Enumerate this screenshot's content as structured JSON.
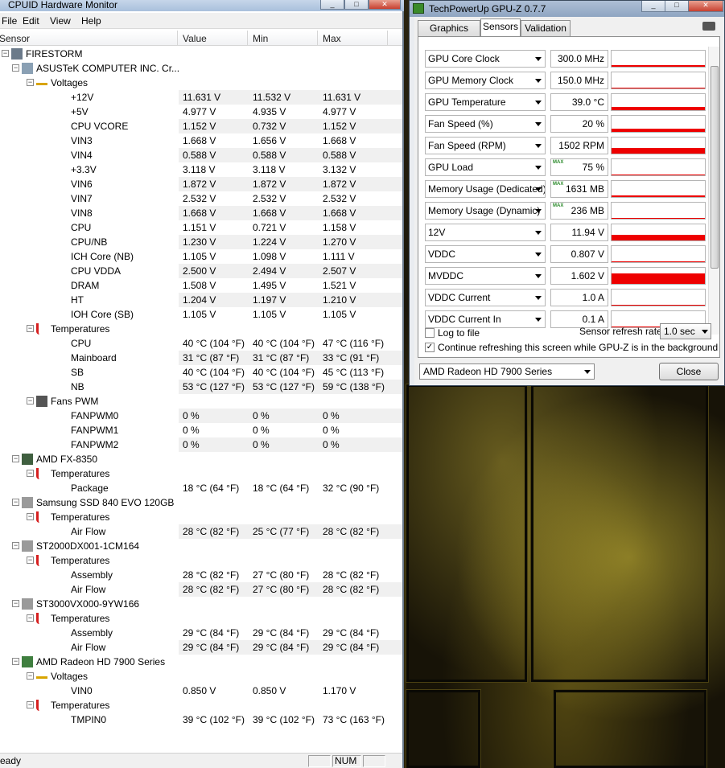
{
  "hwmonitor": {
    "title": "CPUID Hardware Monitor",
    "menu": [
      "File",
      "Edit",
      "View",
      "Help"
    ],
    "columns": {
      "sensor": "Sensor",
      "value": "Value",
      "min": "Min",
      "max": "Max"
    },
    "status": {
      "ready": "eady",
      "num": "NUM"
    },
    "rows": [
      {
        "indent": 0,
        "type": "root",
        "icon": "computer-icon",
        "label": "FIRESTORM"
      },
      {
        "indent": 1,
        "type": "device",
        "icon": "motherboard-icon",
        "label": "ASUSTeK COMPUTER INC. Cr..."
      },
      {
        "indent": 2,
        "type": "group",
        "icon": "voltage-icon",
        "label": "Voltages"
      },
      {
        "indent": 3,
        "type": "sensor",
        "label": "+12V",
        "value": "11.631 V",
        "min": "11.532 V",
        "max": "11.631 V"
      },
      {
        "indent": 3,
        "type": "sensor",
        "label": "+5V",
        "value": "4.977 V",
        "min": "4.935 V",
        "max": "4.977 V"
      },
      {
        "indent": 3,
        "type": "sensor",
        "label": "CPU VCORE",
        "value": "1.152 V",
        "min": "0.732 V",
        "max": "1.152 V"
      },
      {
        "indent": 3,
        "type": "sensor",
        "label": "VIN3",
        "value": "1.668 V",
        "min": "1.656 V",
        "max": "1.668 V"
      },
      {
        "indent": 3,
        "type": "sensor",
        "label": "VIN4",
        "value": "0.588 V",
        "min": "0.588 V",
        "max": "0.588 V"
      },
      {
        "indent": 3,
        "type": "sensor",
        "label": "+3.3V",
        "value": "3.118 V",
        "min": "3.118 V",
        "max": "3.132 V"
      },
      {
        "indent": 3,
        "type": "sensor",
        "label": "VIN6",
        "value": "1.872 V",
        "min": "1.872 V",
        "max": "1.872 V"
      },
      {
        "indent": 3,
        "type": "sensor",
        "label": "VIN7",
        "value": "2.532 V",
        "min": "2.532 V",
        "max": "2.532 V"
      },
      {
        "indent": 3,
        "type": "sensor",
        "label": "VIN8",
        "value": "1.668 V",
        "min": "1.668 V",
        "max": "1.668 V"
      },
      {
        "indent": 3,
        "type": "sensor",
        "label": "CPU",
        "value": "1.151 V",
        "min": "0.721 V",
        "max": "1.158 V"
      },
      {
        "indent": 3,
        "type": "sensor",
        "label": "CPU/NB",
        "value": "1.230 V",
        "min": "1.224 V",
        "max": "1.270 V"
      },
      {
        "indent": 3,
        "type": "sensor",
        "label": "ICH Core (NB)",
        "value": "1.105 V",
        "min": "1.098 V",
        "max": "1.111 V"
      },
      {
        "indent": 3,
        "type": "sensor",
        "label": "CPU VDDA",
        "value": "2.500 V",
        "min": "2.494 V",
        "max": "2.507 V"
      },
      {
        "indent": 3,
        "type": "sensor",
        "label": "DRAM",
        "value": "1.508 V",
        "min": "1.495 V",
        "max": "1.521 V"
      },
      {
        "indent": 3,
        "type": "sensor",
        "label": "HT",
        "value": "1.204 V",
        "min": "1.197 V",
        "max": "1.210 V"
      },
      {
        "indent": 3,
        "type": "sensor",
        "label": "IOH Core (SB)",
        "value": "1.105 V",
        "min": "1.105 V",
        "max": "1.105 V"
      },
      {
        "indent": 2,
        "type": "group",
        "icon": "thermometer-icon",
        "label": "Temperatures"
      },
      {
        "indent": 3,
        "type": "sensor",
        "label": "CPU",
        "value": "40 °C  (104 °F)",
        "min": "40 °C  (104 °F)",
        "max": "47 °C  (116 °F)"
      },
      {
        "indent": 3,
        "type": "sensor",
        "label": "Mainboard",
        "value": "31 °C  (87 °F)",
        "min": "31 °C  (87 °F)",
        "max": "33 °C  (91 °F)"
      },
      {
        "indent": 3,
        "type": "sensor",
        "label": "SB",
        "value": "40 °C  (104 °F)",
        "min": "40 °C  (104 °F)",
        "max": "45 °C  (113 °F)"
      },
      {
        "indent": 3,
        "type": "sensor",
        "label": "NB",
        "value": "53 °C  (127 °F)",
        "min": "53 °C  (127 °F)",
        "max": "59 °C  (138 °F)"
      },
      {
        "indent": 2,
        "type": "group",
        "icon": "fan-icon",
        "label": "Fans PWM"
      },
      {
        "indent": 3,
        "type": "sensor",
        "label": "FANPWM0",
        "value": "0 %",
        "min": "0 %",
        "max": "0 %"
      },
      {
        "indent": 3,
        "type": "sensor",
        "label": "FANPWM1",
        "value": "0 %",
        "min": "0 %",
        "max": "0 %"
      },
      {
        "indent": 3,
        "type": "sensor",
        "label": "FANPWM2",
        "value": "0 %",
        "min": "0 %",
        "max": "0 %"
      },
      {
        "indent": 1,
        "type": "device",
        "icon": "cpu-chip-icon",
        "label": "AMD FX-8350"
      },
      {
        "indent": 2,
        "type": "group",
        "icon": "thermometer-icon",
        "label": "Temperatures"
      },
      {
        "indent": 3,
        "type": "sensor",
        "label": "Package",
        "value": "18 °C  (64 °F)",
        "min": "18 °C  (64 °F)",
        "max": "32 °C  (90 °F)"
      },
      {
        "indent": 1,
        "type": "device",
        "icon": "drive-icon",
        "label": "Samsung SSD 840 EVO 120GB"
      },
      {
        "indent": 2,
        "type": "group",
        "icon": "thermometer-icon",
        "label": "Temperatures"
      },
      {
        "indent": 3,
        "type": "sensor",
        "label": "Air Flow",
        "value": "28 °C  (82 °F)",
        "min": "25 °C  (77 °F)",
        "max": "28 °C  (82 °F)"
      },
      {
        "indent": 1,
        "type": "device",
        "icon": "drive-icon",
        "label": "ST2000DX001-1CM164"
      },
      {
        "indent": 2,
        "type": "group",
        "icon": "thermometer-icon",
        "label": "Temperatures"
      },
      {
        "indent": 3,
        "type": "sensor",
        "label": "Assembly",
        "value": "28 °C  (82 °F)",
        "min": "27 °C  (80 °F)",
        "max": "28 °C  (82 °F)"
      },
      {
        "indent": 3,
        "type": "sensor",
        "label": "Air Flow",
        "value": "28 °C  (82 °F)",
        "min": "27 °C  (80 °F)",
        "max": "28 °C  (82 °F)"
      },
      {
        "indent": 1,
        "type": "device",
        "icon": "drive-icon",
        "label": "ST3000VX000-9YW166"
      },
      {
        "indent": 2,
        "type": "group",
        "icon": "thermometer-icon",
        "label": "Temperatures"
      },
      {
        "indent": 3,
        "type": "sensor",
        "label": "Assembly",
        "value": "29 °C  (84 °F)",
        "min": "29 °C  (84 °F)",
        "max": "29 °C  (84 °F)"
      },
      {
        "indent": 3,
        "type": "sensor",
        "label": "Air Flow",
        "value": "29 °C  (84 °F)",
        "min": "29 °C  (84 °F)",
        "max": "29 °C  (84 °F)"
      },
      {
        "indent": 1,
        "type": "device",
        "icon": "graphics-card-icon",
        "label": "AMD Radeon HD 7900 Series"
      },
      {
        "indent": 2,
        "type": "group",
        "icon": "voltage-icon",
        "label": "Voltages"
      },
      {
        "indent": 3,
        "type": "sensor",
        "label": "VIN0",
        "value": "0.850 V",
        "min": "0.850 V",
        "max": "1.170 V"
      },
      {
        "indent": 2,
        "type": "group",
        "icon": "thermometer-icon",
        "label": "Temperatures"
      },
      {
        "indent": 3,
        "type": "sensor",
        "label": "TMPIN0",
        "value": "39 °C  (102 °F)",
        "min": "39 °C  (102 °F)",
        "max": "73 °C  (163 °F)"
      }
    ]
  },
  "gpuz": {
    "title": "TechPowerUp GPU-Z 0.7.7",
    "tabs": [
      "Graphics Card",
      "Sensors",
      "Validation"
    ],
    "active_tab": "Sensors",
    "max_marker": "MAX",
    "sensors": [
      {
        "name": "GPU Core Clock",
        "value": "300.0 MHz",
        "level": 0.1,
        "max": false
      },
      {
        "name": "GPU Memory Clock",
        "value": "150.0 MHz",
        "level": 0.05,
        "max": false
      },
      {
        "name": "GPU Temperature",
        "value": "39.0 °C",
        "level": 0.18,
        "max": false
      },
      {
        "name": "Fan Speed (%)",
        "value": "20 %",
        "level": 0.2,
        "max": false
      },
      {
        "name": "Fan Speed (RPM)",
        "value": "1502 RPM",
        "level": 0.35,
        "max": false
      },
      {
        "name": "GPU Load",
        "value": "75 %",
        "level": 0.0,
        "max": true
      },
      {
        "name": "Memory Usage (Dedicated)",
        "value": "1631 MB",
        "level": 0.08,
        "max": true
      },
      {
        "name": "Memory Usage (Dynamic)",
        "value": "236 MB",
        "level": 0.05,
        "max": true
      },
      {
        "name": "12V",
        "value": "11.94 V",
        "level": 0.35,
        "max": false
      },
      {
        "name": "VDDC",
        "value": "0.807 V",
        "level": 0.05,
        "max": false
      },
      {
        "name": "MVDDC",
        "value": "1.602 V",
        "level": 0.65,
        "max": false
      },
      {
        "name": "VDDC Current",
        "value": "1.0 A",
        "level": 0.03,
        "max": false
      },
      {
        "name": "VDDC Current In",
        "value": "0.1 A",
        "level": 0.02,
        "max": false
      }
    ],
    "log_to_file": "Log to file",
    "log_checked": false,
    "refresh_label": "Sensor refresh rate:",
    "refresh_value": "1.0 sec",
    "continue_label": "Continue refreshing this screen while GPU-Z is in the background",
    "continue_checked": true,
    "gpu_select": "AMD Radeon HD 7900 Series",
    "close_label": "Close",
    "bar_color": "#ee0000"
  }
}
